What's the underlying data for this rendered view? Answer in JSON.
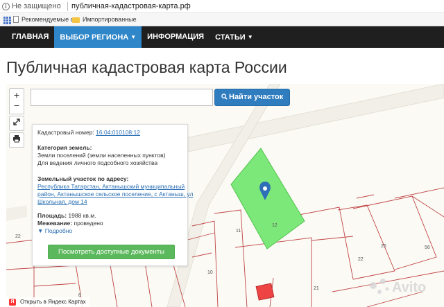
{
  "browser": {
    "security_label": "Не защищено",
    "url": "публичная-кадастровая-карта.рф",
    "bookmarks": [
      "Рекомендуемые са",
      "Импортированные"
    ]
  },
  "nav": {
    "items": [
      {
        "label": "ГЛАВНАЯ",
        "active": false
      },
      {
        "label": "ВЫБОР РЕГИОНА",
        "active": true,
        "dropdown": true
      },
      {
        "label": "ИНФОРМАЦИЯ",
        "active": false
      },
      {
        "label": "СТАТЬИ",
        "active": false,
        "dropdown": true
      }
    ]
  },
  "page": {
    "title": "Публичная кадастровая карта России"
  },
  "map": {
    "zoom_in": "+",
    "zoom_out": "−",
    "search_placeholder": "",
    "search_button": "Найти участок",
    "plot_labels": [
      "12",
      "11",
      "22",
      "10",
      "22",
      "21",
      "25",
      "56",
      "8"
    ],
    "plot_color": "#7de87a",
    "yandex_link": "Открыть в Яндекс Картах",
    "watermark": "Avito"
  },
  "info": {
    "cadastral_label": "Кадастровый номер:",
    "cadastral_number": "16:04:010108:12",
    "category_label": "Категория земель:",
    "category_line1": "Земли поселений (земли населенных пунктов)",
    "category_line2": "Для ведения личного подсобного хозяйства",
    "address_label": "Земельный участок по адресу:",
    "address_lines": [
      "Республика Татарстан, Актанышский муниципальный",
      "район, Актанышское сельское поселение, с Актаныш, ул",
      "Школьная, дом 14"
    ],
    "area_label": "Площадь:",
    "area_value": "1988 кв.м.",
    "survey_label": "Межевание:",
    "survey_value": "проведено",
    "more_label": "Подробно",
    "docs_button": "Посмотреть доступные документы"
  }
}
